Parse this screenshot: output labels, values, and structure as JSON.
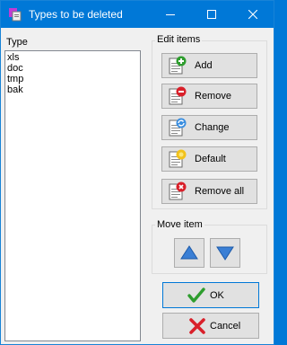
{
  "window": {
    "title": "Types to be deleted"
  },
  "list": {
    "label": "Type",
    "items": [
      "xls",
      "doc",
      "tmp",
      "bak"
    ]
  },
  "edit_items": {
    "caption": "Edit items",
    "add_label": "Add",
    "remove_label": "Remove",
    "change_label": "Change",
    "default_label": "Default",
    "remove_all_label": "Remove all"
  },
  "move_item": {
    "caption": "Move item"
  },
  "dialog": {
    "ok_label": "OK",
    "cancel_label": "Cancel"
  },
  "icons": {
    "add": "document-plus-icon",
    "remove": "document-minus-icon",
    "change": "document-refresh-icon",
    "default": "document-star-icon",
    "remove_all": "document-x-icon",
    "up": "triangle-up-icon",
    "down": "triangle-down-icon",
    "ok": "green-check-icon",
    "cancel": "red-x-icon"
  },
  "colors": {
    "titlebar": "#0078d7",
    "arrow_blue": "#3a7fd5",
    "ok_green": "#2e9d2e",
    "cancel_red": "#d9202a"
  }
}
